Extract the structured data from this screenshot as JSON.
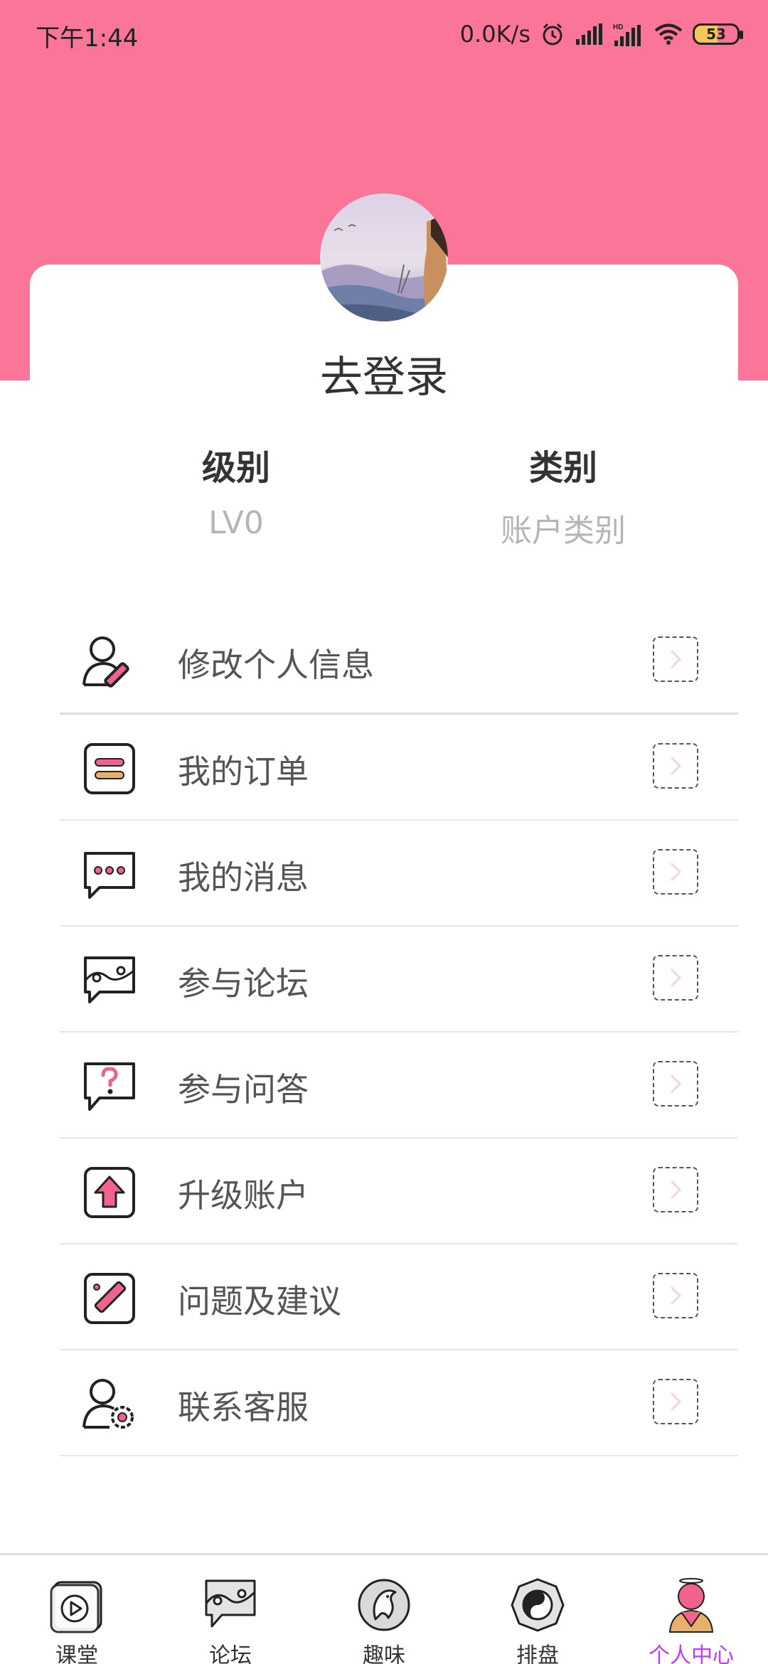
{
  "status_bar": {
    "time": "下午1:44",
    "net_speed": "0.0K/s",
    "battery": "53"
  },
  "profile": {
    "login_text": "去登录",
    "level_label": "级别",
    "level_value": "LV0",
    "type_label": "类别",
    "type_value": "账户类别"
  },
  "menu": {
    "items": [
      {
        "label": "修改个人信息",
        "icon": "user-edit-icon"
      },
      {
        "label": "我的订单",
        "icon": "order-icon"
      },
      {
        "label": "我的消息",
        "icon": "message-icon"
      },
      {
        "label": "参与论坛",
        "icon": "forum-icon"
      },
      {
        "label": "参与问答",
        "icon": "question-icon"
      },
      {
        "label": "升级账户",
        "icon": "upgrade-icon"
      },
      {
        "label": "问题及建议",
        "icon": "feedback-icon"
      },
      {
        "label": "联系客服",
        "icon": "customer-service-icon"
      }
    ]
  },
  "tabbar": {
    "tabs": [
      {
        "label": "课堂",
        "icon": "classroom-icon"
      },
      {
        "label": "论坛",
        "icon": "forum-tab-icon"
      },
      {
        "label": "趣味",
        "icon": "fun-icon"
      },
      {
        "label": "排盘",
        "icon": "chart-plate-icon"
      },
      {
        "label": "个人中心",
        "icon": "personal-center-icon"
      }
    ],
    "active_index": 4
  },
  "colors": {
    "header": "#fb7599",
    "active_tab": "#c23aff",
    "accent_pink": "#f0638d"
  }
}
